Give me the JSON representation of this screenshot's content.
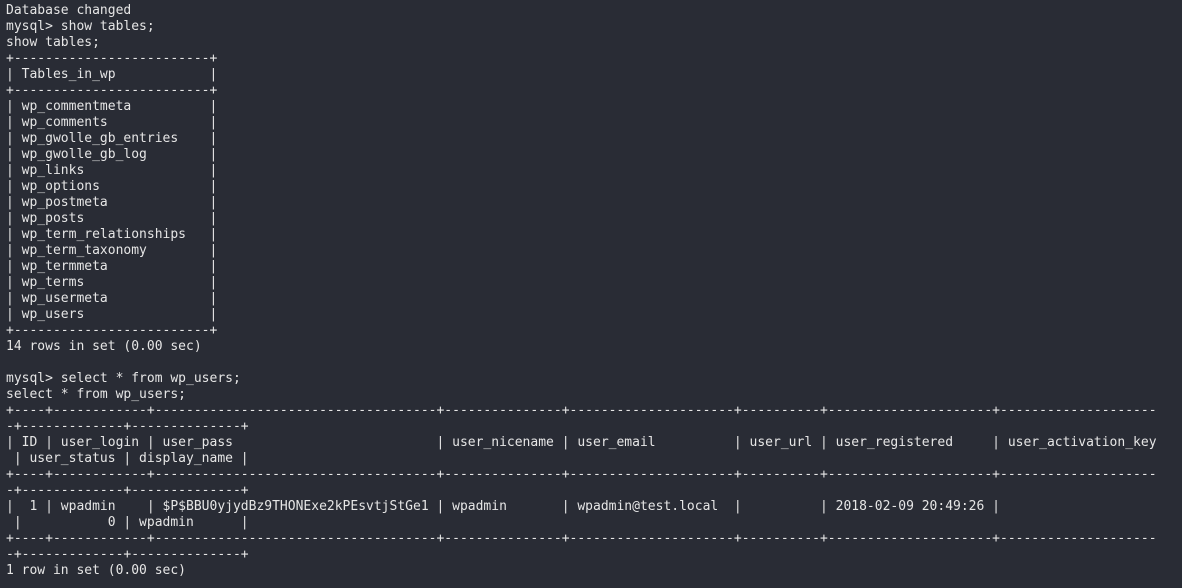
{
  "terminal": {
    "lines": [
      "Database changed",
      "mysql> show tables;",
      "show tables;",
      "+-------------------------+",
      "| Tables_in_wp            |",
      "+-------------------------+",
      "| wp_commentmeta          |",
      "| wp_comments             |",
      "| wp_gwolle_gb_entries    |",
      "| wp_gwolle_gb_log        |",
      "| wp_links                |",
      "| wp_options              |",
      "| wp_postmeta             |",
      "| wp_posts                |",
      "| wp_term_relationships   |",
      "| wp_term_taxonomy        |",
      "| wp_termmeta             |",
      "| wp_terms                |",
      "| wp_usermeta             |",
      "| wp_users                |",
      "+-------------------------+",
      "14 rows in set (0.00 sec)",
      "",
      "mysql> select * from wp_users;",
      "select * from wp_users;",
      "+----+------------+------------------------------------+---------------+---------------------+----------+---------------------+--------------------",
      "-+-------------+--------------+",
      "| ID | user_login | user_pass                          | user_nicename | user_email          | user_url | user_registered     | user_activation_key",
      " | user_status | display_name |",
      "+----+------------+------------------------------------+---------------+---------------------+----------+---------------------+--------------------",
      "-+-------------+--------------+",
      "|  1 | wpadmin    | $P$BBU0yjydBz9THONExe2kPEsvtjStGe1 | wpadmin       | wpadmin@test.local  |          | 2018-02-09 20:49:26 |",
      " |           0 | wpadmin      |",
      "+----+------------+------------------------------------+---------------+---------------------+----------+---------------------+--------------------",
      "-+-------------+--------------+",
      "1 row in set (0.00 sec)"
    ]
  }
}
